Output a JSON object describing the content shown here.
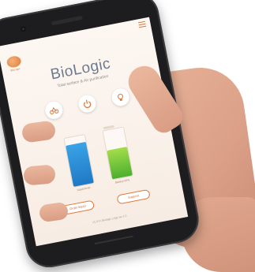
{
  "app": {
    "title": "BioLogic",
    "subtitle": "Total surface & Air purification",
    "logo_text": "BioLogic"
  },
  "modes": [
    {
      "label": "",
      "icon": "surface-icon"
    },
    {
      "label": "",
      "icon": "power-icon"
    },
    {
      "label": "",
      "icon": "lamp-icon"
    }
  ],
  "levels": [
    {
      "label": "Liquid level",
      "fill": 0.85,
      "color": "#2a8fd8"
    },
    {
      "label": "Battery 60%",
      "fill": 0.6,
      "color": "#6cc33a"
    }
  ],
  "buttons": {
    "left": "Order liquid",
    "right": "Support"
  },
  "footer": "v1.0.0 | Biologic | App ver 1.0",
  "colors": {
    "accent": "#e07a3a",
    "title": "#6b7a8e"
  }
}
